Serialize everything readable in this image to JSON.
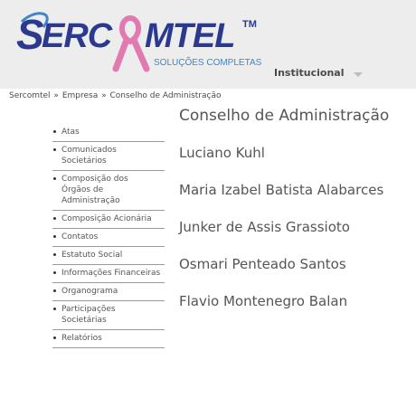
{
  "brand": {
    "name": "SERCOMTEL",
    "trademark": "TM",
    "tagline": "SOLUÇÕES COMPLETAS",
    "colors": {
      "blue": "#2b3a8f",
      "pink": "#e07ab0",
      "light_blue": "#3f86c6"
    }
  },
  "top_nav": {
    "label": "Institucional",
    "icon": "chevron-down-icon"
  },
  "breadcrumb": {
    "items": [
      "Sercomtel",
      "Empresa",
      "Conselho de Administração"
    ],
    "separator": "»"
  },
  "sidebar": {
    "items": [
      {
        "label": "Atas"
      },
      {
        "label": "Comunicados Societários"
      },
      {
        "label": "Composição dos Órgãos de Administração"
      },
      {
        "label": "Composição Acionária"
      },
      {
        "label": "Contatos"
      },
      {
        "label": "Estatuto Social"
      },
      {
        "label": "Informações Financeiras"
      },
      {
        "label": "Organograma"
      },
      {
        "label": "Participações Societárias"
      },
      {
        "label": "Relatórios"
      }
    ]
  },
  "main": {
    "title": "Conselho de Administração",
    "members": [
      "Luciano Kuhl",
      "Maria Izabel Batista Alabarces",
      "Junker de Assis Grassioto",
      "Osmari Penteado Santos",
      "Flavio Montenegro Balan"
    ]
  }
}
